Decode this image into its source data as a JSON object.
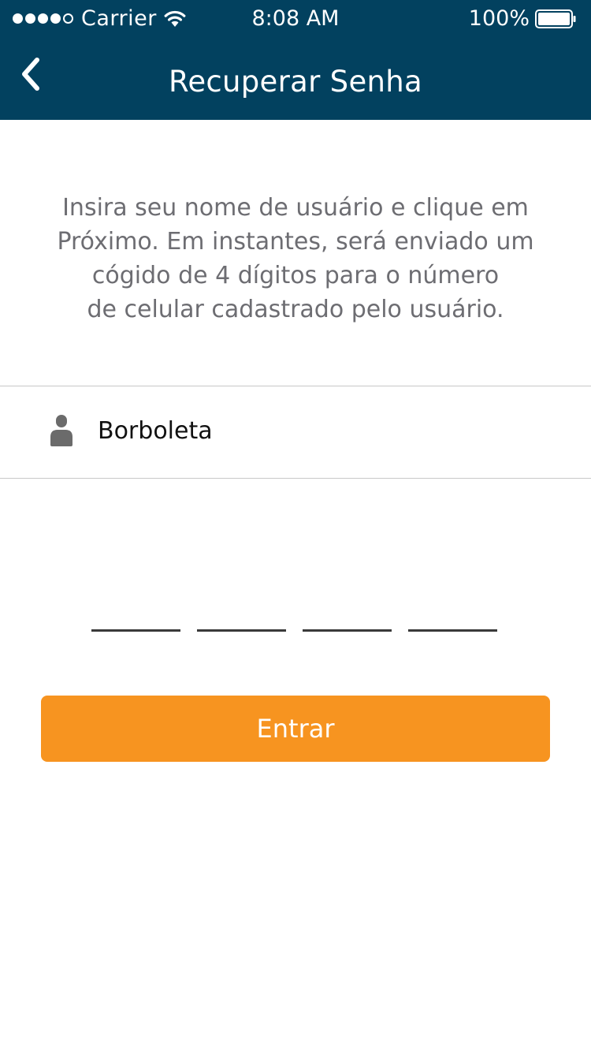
{
  "status_bar": {
    "carrier": "Carrier",
    "time": "8:08 AM",
    "battery": "100%",
    "signal_icon": "signal-dots-icon",
    "wifi_icon": "wifi-icon",
    "battery_icon": "battery-icon"
  },
  "nav": {
    "title": "Recuperar Senha",
    "back_icon": "chevron-left-icon"
  },
  "instructions": {
    "line1": "Insira seu nome de usuário e clique em",
    "line2": "Próximo. Em instantes, será enviado um",
    "line3": "cógido de 4 dígitos para o número",
    "line4": "de celular cadastrado pelo usuário."
  },
  "username_field": {
    "icon": "user-icon",
    "value": "Borboleta"
  },
  "code": {
    "digits": [
      "",
      "",
      "",
      ""
    ]
  },
  "button": {
    "label": "Entrar"
  },
  "colors": {
    "header_bg": "#02415f",
    "button_bg": "#f79420",
    "instruction_text": "#6d6d72"
  }
}
